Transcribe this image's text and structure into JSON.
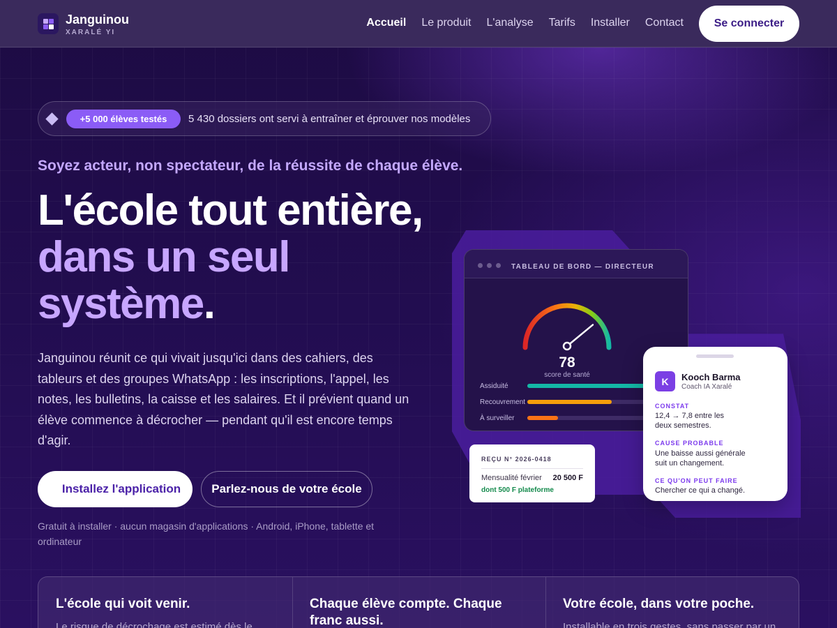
{
  "nav": {
    "brand": "Janguinou",
    "brand_sub": "XARALÉ YI",
    "links": [
      "Accueil",
      "Le produit",
      "L'analyse",
      "Tarifs",
      "Installer",
      "Contact"
    ],
    "active_link": "Accueil",
    "login_label": "Se connecter"
  },
  "hero": {
    "badge_tag": "+5 000 élèves testés",
    "badge_text": "5 430 dossiers ont servi à entraîner et éprouver nos modèles",
    "kicker": "Soyez acteur, non spectateur, de la réussite de chaque élève.",
    "title_line1": "L'école tout entière,",
    "title_line2": "dans un seul",
    "title_line3": "système",
    "title_dot": ".",
    "lead": "Janguinou réunit ce qui vivait jusqu'ici dans des cahiers, des tableurs et des groupes WhatsApp : les inscriptions, l'appel, les notes, les bulletins, la caisse et les salaires. Et il prévient quand un élève commence à décrocher — pendant qu'il est encore temps d'agir.",
    "cta_primary": "Installez l'application",
    "cta_secondary": "Parlez-nous de votre école",
    "note": "Gratuit à installer · aucun magasin d'applications · Android, iPhone, tablette et ordinateur"
  },
  "dashboard": {
    "title": "TABLEAU DE BORD — DIRECTEUR",
    "score": "78",
    "score_label": "score de santé",
    "gauge_value": 78,
    "metrics": [
      {
        "label": "Assiduité",
        "value": 0.88,
        "color": "#14b8a6"
      },
      {
        "label": "Recouvrement",
        "value": 0.52,
        "color": "#f59e0b"
      },
      {
        "label": "À surveiller",
        "value": 0.19,
        "color": "#f97316"
      }
    ]
  },
  "receipt": {
    "title": "REÇU N° 2026-0418",
    "label": "Mensualité février",
    "amount": "20 500 F",
    "fee": "dont 500 F plateforme"
  },
  "coach": {
    "avatar_letter": "K",
    "name": "Kooch Barma",
    "role": "Coach IA Xaralé",
    "sections": [
      {
        "head": "CONSTAT",
        "body_line1": "12,4 → 7,8 entre les",
        "body_line2": "deux semestres."
      },
      {
        "head": "CAUSE PROBABLE",
        "body_line1": "Une baisse aussi générale",
        "body_line2": "suit un changement."
      },
      {
        "head": "CE QU'ON PEUT FAIRE",
        "body_line1": "Chercher ce qui a changé."
      }
    ]
  },
  "features": [
    {
      "title_line1": "L'école qui voit venir.",
      "title_line2": "",
      "desc": "Le risque de décrochage est estimé dès le"
    },
    {
      "title_line1": "Chaque élève compte. Chaque",
      "title_line2": "franc aussi.",
      "desc": ""
    },
    {
      "title_line1": "Votre école, dans votre poche.",
      "title_line2": "",
      "desc": "Installable en trois gestes, sans passer par un"
    }
  ],
  "colors": {
    "background": "#1e0c46",
    "accent_purple": "#8b5cf6",
    "title_purple": "#c7a6ff",
    "cta_text": "#4b22a8"
  }
}
